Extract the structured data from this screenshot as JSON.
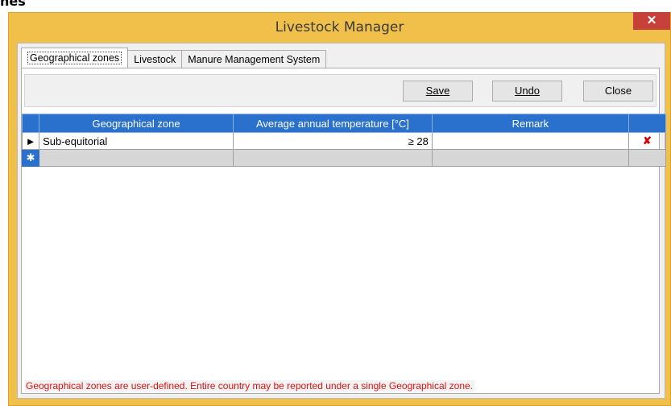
{
  "bg_text": "nes",
  "window": {
    "title": "Livestock Manager",
    "close_glyph": "✕"
  },
  "tabs": [
    {
      "label": "Geographical zones"
    },
    {
      "label": "Livestock"
    },
    {
      "label": "Manure Management System"
    }
  ],
  "toolbar": {
    "save_label": "Save",
    "undo_label": "Undo",
    "close_label": "Close"
  },
  "grid": {
    "columns": [
      "Geographical zone",
      "Average annual temperature [°C]",
      "Remark"
    ],
    "rows": [
      {
        "zone": "Sub-equitorial",
        "temperature": "≥ 28",
        "remark": ""
      }
    ],
    "current_row_marker": "►",
    "new_row_marker": "✱",
    "delete_glyph": "✘"
  },
  "note": "Geographical zones are user-defined. Entire country may be reported under a single Geographical zone.",
  "colors": {
    "title_bar": "#f0c04a",
    "close_button": "#c7413a",
    "grid_header": "#2a70cd",
    "note_text": "#e01010"
  }
}
